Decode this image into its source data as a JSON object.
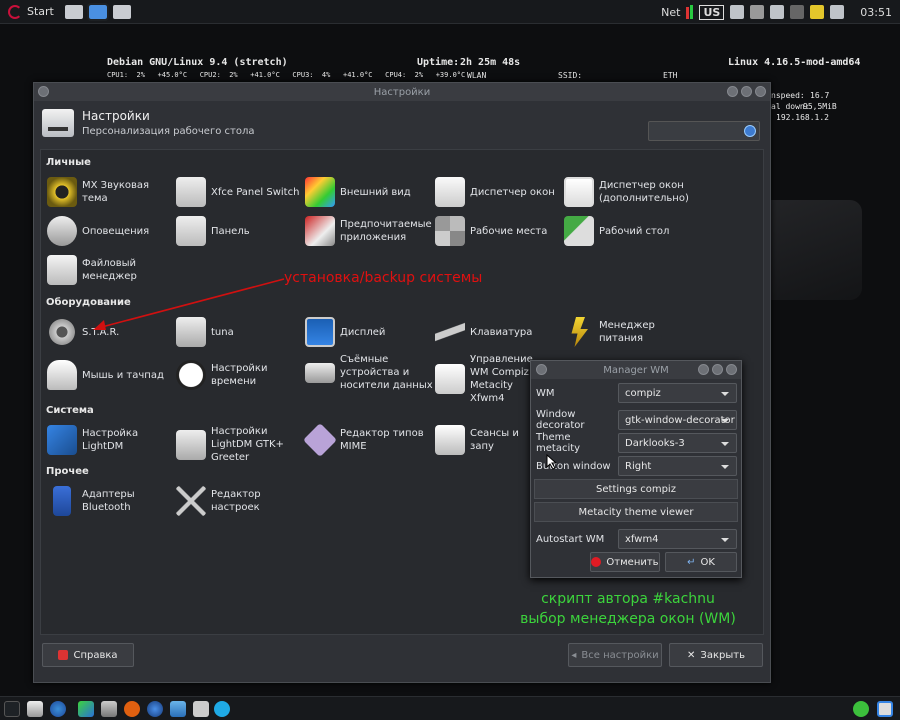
{
  "top_panel": {
    "start_label": "Start",
    "net_label": "Net",
    "kbd_layout": "US",
    "clock": "03:51"
  },
  "conky": {
    "os": "Debian GNU/Linux 9.4 (stretch)",
    "uptime_label": "Uptime:",
    "uptime": "2h 25m 48s",
    "kernel": "Linux 4.16.5-mod-amd64",
    "cpu_line": "CPU1:  2%   +45.0°C   CPU2:  2%   +41.0°C   CPU3:  4%   +41.0°C   CPU4:  2%   +39.0°C",
    "wlan": "WLAN",
    "ssid": "SSID:",
    "eth": "ETH",
    "speed_label": "nspeed:",
    "speed_val": "16.7",
    "down_label": "al down:",
    "down_val": "95,5MiB",
    "ip": "192.168.1.2"
  },
  "window": {
    "title": "Настройки",
    "header_title": "Настройки",
    "header_subtitle": "Персонализация рабочего стола"
  },
  "sections": {
    "personal": "Личные",
    "hardware": "Оборудование",
    "system": "Система",
    "other": "Прочее"
  },
  "items": {
    "p1": "MX Звуковая тема",
    "p2": "Xfce Panel Switch",
    "p3": "Внешний вид",
    "p4": "Диспетчер окон",
    "p5": "Диспетчер окон (дополнительно)",
    "p6": "Оповещения",
    "p7": "Панель",
    "p8": "Предпочитаемые приложения",
    "p9": "Рабочие места",
    "p10": "Рабочий стол",
    "p11": "Файловый менеджер",
    "h1": "S.T.A.R.",
    "h2": "tuna",
    "h3": "Дисплей",
    "h4": "Клавиатура",
    "h5": "Менеджер питания",
    "h6": "Мышь и тачпад",
    "h7": "Настройки времени",
    "h8": "Съёмные устройства и носители данных",
    "h9": "Управление WM Compiz Metacity Xfwm4",
    "s1": "Настройка LightDM",
    "s2": "Настройки LightDM GTK+ Greeter",
    "s3": "Редактор типов MIME",
    "s4": "Сеансы и запу",
    "o1": "Адаптеры Bluetooth",
    "o2": "Редактор настроек"
  },
  "buttons": {
    "help": "Справка",
    "all_settings": "Все настройки",
    "close": "Закрыть"
  },
  "annotations": {
    "red": "установка/backup системы",
    "green1": "скрипт автора #kachnu",
    "green2": "выбор менеджера окон (WM)"
  },
  "manager_wm": {
    "title": "Manager WM",
    "wm_label": "WM",
    "wm_value": "compiz",
    "decorator_label": "Window decorator",
    "decorator_value": "gtk-window-decorator",
    "theme_label": "Theme metacity",
    "theme_value": "Darklooks-3",
    "button_label": "Button window",
    "button_value": "Right",
    "settings_compiz": "Settings compiz",
    "metacity_viewer": "Metacity theme viewer",
    "autostart_label": "Autostart WM",
    "autostart_value": "xfwm4",
    "cancel": "Отменить",
    "ok": "OK"
  }
}
